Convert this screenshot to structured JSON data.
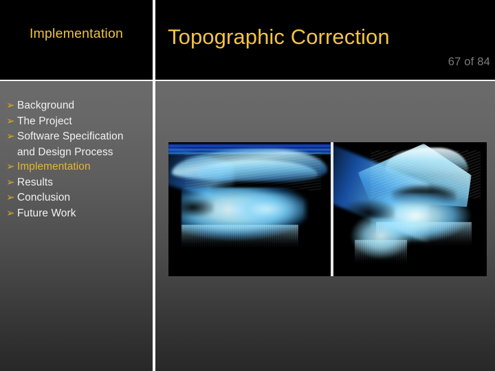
{
  "slide": {
    "section_heading": "Implementation",
    "title": "Topographic Correction",
    "page_counter": "67 of 84",
    "accent_gold": "#F2C445",
    "accent_bullet": "#D8A820",
    "counter_gray": "#7C7C7C",
    "header_background": "#000000",
    "divider_color": "#FBFBFB"
  },
  "agenda": {
    "bullet_glyph": "➢",
    "bullet_icon_name": "chevron-arrow-bullet-icon",
    "items": [
      {
        "label": "Background",
        "current": false
      },
      {
        "label": "The Project",
        "current": false
      },
      {
        "label": "Software Specification",
        "continuation": "and Design Process",
        "current": false
      },
      {
        "label": "Implementation",
        "current": true
      },
      {
        "label": "Results",
        "current": false
      },
      {
        "label": "Conclusion",
        "current": false
      },
      {
        "label": "Future Work",
        "current": false
      }
    ]
  },
  "figure": {
    "caption": "",
    "panels": [
      {
        "name": "uncorrected-terrain-render",
        "description": "Blue and cyan 3D volume rendering of terrain surface on black background, viewed at a shallow oblique angle with a flat horizontal ridge band across the top."
      },
      {
        "name": "topographically-corrected-terrain-render",
        "description": "Blue and cyan 3D volume rendering of the same terrain on black background, viewed from a rotated angle showing a pronounced triangular peak and draped flank."
      }
    ]
  }
}
